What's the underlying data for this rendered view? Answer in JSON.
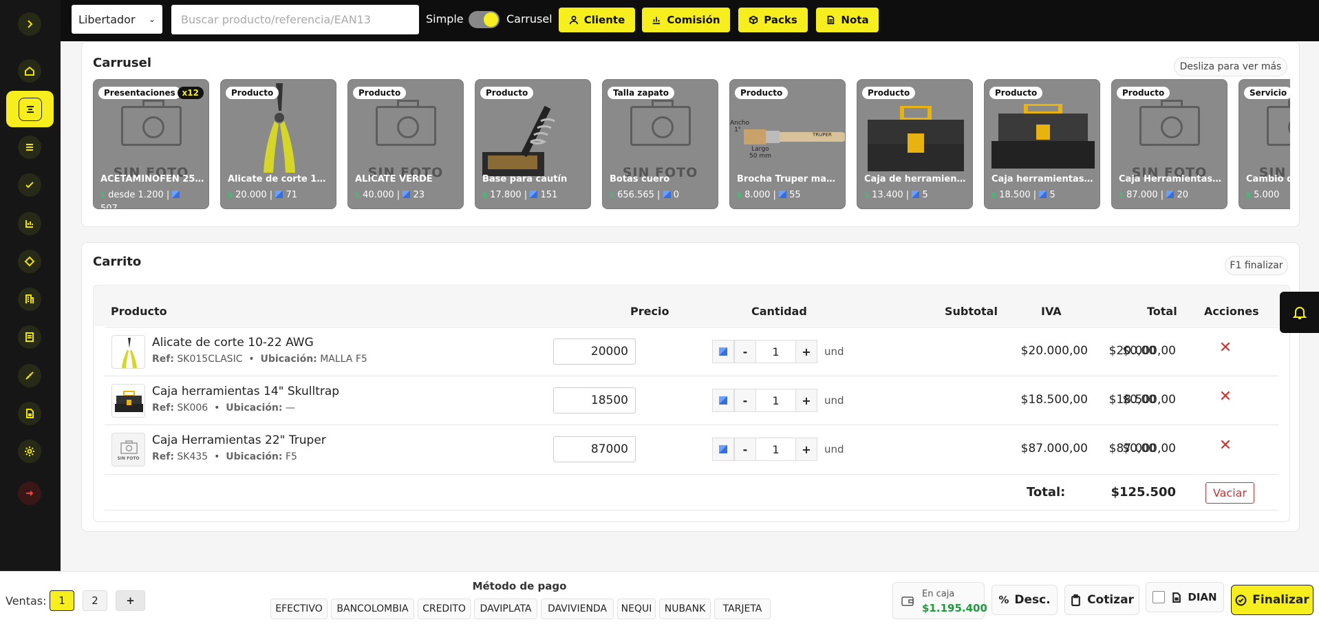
{
  "topbar": {
    "store_select": "Libertador",
    "search_placeholder": "Buscar producto/referencia/EAN13",
    "mode_simple": "Simple",
    "mode_carrusel": "Carrusel",
    "buttons": {
      "cliente": "Cliente",
      "comision": "Comisión",
      "packs": "Packs",
      "nota": "Nota"
    }
  },
  "carousel": {
    "title": "Carrusel",
    "hint": "Desliza para ver más",
    "no_photo": "SIN FOTO",
    "cards": [
      {
        "badge": "Presentaciones",
        "count": "x12",
        "name": "ACETAMINOFEN 25…",
        "price": "desde 1.200",
        "stock": "507"
      },
      {
        "badge": "Producto",
        "name": "Alicate de corte 10-…",
        "price": "20.000",
        "stock": "71"
      },
      {
        "badge": "Producto",
        "name": "ALICATE VERDE",
        "price": "40.000",
        "stock": "23"
      },
      {
        "badge": "Producto",
        "name": "Base para cautín",
        "price": "17.800",
        "stock": "151"
      },
      {
        "badge": "Talla zapato",
        "name": "Botas cuero",
        "price": "656.565",
        "stock": "0"
      },
      {
        "badge": "Producto",
        "name": "Brocha Truper mad…",
        "price": "8.000",
        "stock": "55",
        "brush_text": {
          "ancho": "Ancho",
          "ancho_val": "1\"",
          "largo": "Largo",
          "largo_val": "50 mm",
          "brand": "TRUPER"
        }
      },
      {
        "badge": "Producto",
        "name": "Caja de herramien…",
        "price": "13.400",
        "stock": "5"
      },
      {
        "badge": "Producto",
        "name": "Caja herramientas …",
        "price": "18.500",
        "stock": "5"
      },
      {
        "badge": "Producto",
        "name": "Caja Herramientas…",
        "price": "87.000",
        "stock": "20"
      },
      {
        "badge": "Servicio",
        "name": "Cambio de…",
        "price": "5.000",
        "stock": ""
      }
    ]
  },
  "cart": {
    "title": "Carrito",
    "hint": "F1 finalizar",
    "columns": {
      "producto": "Producto",
      "precio": "Precio",
      "cantidad": "Cantidad",
      "subtotal": "Subtotal",
      "iva": "IVA",
      "total": "Total",
      "acciones": "Acciones"
    },
    "ref_label": "Ref:",
    "ubicacion_label": "Ubicación:",
    "minus": "-",
    "plus": "+",
    "unit": "und",
    "remove": "✕",
    "rows": [
      {
        "name": "Alicate de corte 10-22 AWG",
        "ref": "SK015CLASIC",
        "ubicacion": "MALLA F5",
        "price": "20000",
        "qty": "1",
        "subtotal": "$20.000,00",
        "iva": "$0,00",
        "total": "$20.000,00"
      },
      {
        "name": "Caja herramientas 14\" Skulltrap",
        "ref": "SK006",
        "ubicacion": "—",
        "price": "18500",
        "qty": "1",
        "subtotal": "$18.500,00",
        "iva": "$0,00",
        "total": "$18.500,00"
      },
      {
        "name": "Caja Herramientas 22\" Truper",
        "ref": "SK435",
        "ubicacion": "F5",
        "price": "87000",
        "qty": "1",
        "subtotal": "$87.000,00",
        "iva": "$0,00",
        "total": "$87.000,00"
      }
    ],
    "total_label": "Total:",
    "total_value": "$125.500",
    "clear_label": "Vaciar"
  },
  "footer": {
    "ventas_label": "Ventas:",
    "ventas": [
      "1",
      "2"
    ],
    "add": "+",
    "metodo_label": "Método de pago",
    "methods": [
      "EFECTIVO",
      "BANCOLOMBIA",
      "CREDITO",
      "DAVIPLATA",
      "DAVIVIENDA",
      "NEQUI",
      "NUBANK",
      "TARJETA"
    ],
    "caja_label": "En caja",
    "caja_value": "$1.195.400",
    "desc": "Desc.",
    "cotizar": "Cotizar",
    "dian": "DIAN",
    "finalizar": "Finalizar"
  },
  "colors": {
    "accent": "#f7ef1d",
    "dark": "#0e0e0e",
    "money": "#1a9e3a",
    "danger": "#d0302f"
  }
}
